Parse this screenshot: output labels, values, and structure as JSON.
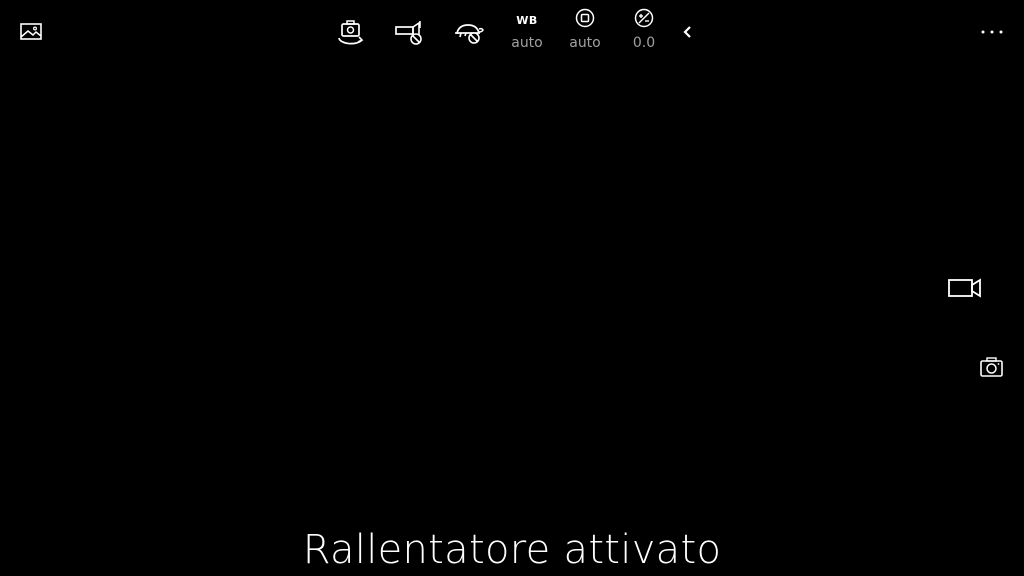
{
  "toolbar": {
    "white_balance": {
      "label": "WB",
      "value": "auto"
    },
    "focus": {
      "value": "auto"
    },
    "exposure": {
      "value": "0.0"
    }
  },
  "icons": {
    "gallery": "image-icon",
    "switch_camera": "camera-switch-icon",
    "flash": "flash-off-icon",
    "slow_motion": "slow-motion-off-icon",
    "focus": "focus-icon",
    "exposure": "exposure-icon",
    "collapse": "chevron-left-icon",
    "more": "more-icon",
    "video_mode": "video-camera-icon",
    "photo_mode": "camera-icon"
  },
  "more_label": "···",
  "status_message": "Rallentatore attivato",
  "colors": {
    "background": "#000000",
    "foreground": "#ffffff",
    "secondary_text": "#a0a0a0"
  }
}
